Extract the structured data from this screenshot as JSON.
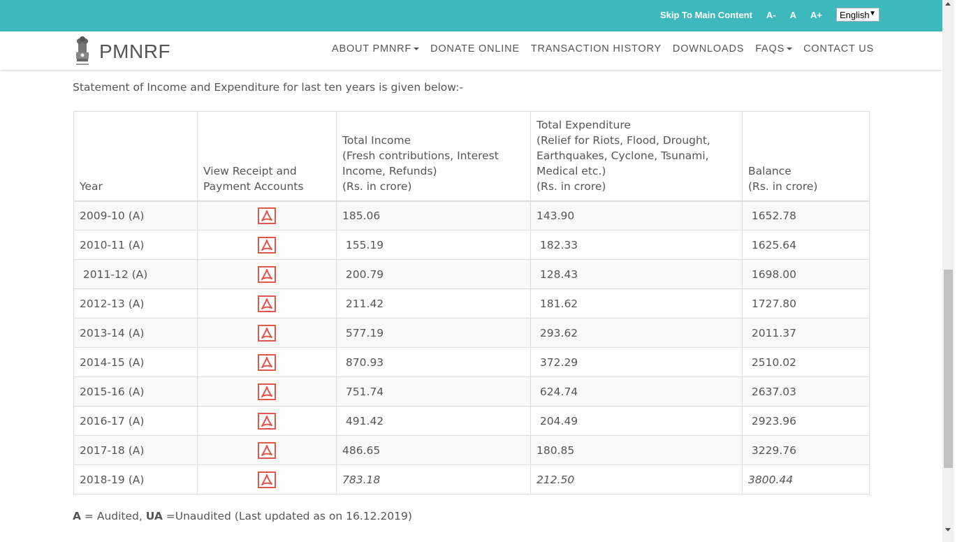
{
  "topbar": {
    "skip_link": "Skip To Main Content",
    "font_decrease": "A-",
    "font_normal": "A",
    "font_increase": "A+",
    "language": "English"
  },
  "nav": {
    "brand": "PMNRF",
    "items": [
      {
        "label": "ABOUT PMNRF",
        "dropdown": true
      },
      {
        "label": "DONATE ONLINE",
        "dropdown": false
      },
      {
        "label": "TRANSACTION HISTORY",
        "dropdown": false
      },
      {
        "label": "DOWNLOADS",
        "dropdown": false
      },
      {
        "label": "FAQS",
        "dropdown": true
      },
      {
        "label": "CONTACT US",
        "dropdown": false
      }
    ]
  },
  "intro": "Statement of Income and Expenditure for last ten years is given below:-",
  "table": {
    "headers": [
      [
        "Year"
      ],
      [
        "View Receipt and",
        "Payment Accounts"
      ],
      [
        "Total Income",
        "(Fresh contributions, Interest",
        "Income, Refunds)",
        "(Rs. in crore)"
      ],
      [
        "Total Expenditure",
        "(Relief for Riots, Flood, Drought,",
        "Earthquakes, Cyclone, Tsunami,",
        "Medical etc.)",
        "(Rs. in crore)"
      ],
      [
        "Balance",
        "(Rs. in crore)"
      ]
    ],
    "rows": [
      {
        "year": "2009-10 (A)",
        "income": "185.06",
        "expenditure": "143.90",
        "balance": " 1652.78",
        "italic": false
      },
      {
        "year": "2010-11 (A)",
        "income": " 155.19",
        "expenditure": " 182.33",
        "balance": " 1625.64",
        "italic": false
      },
      {
        "year": " 2011-12 (A)",
        "income": " 200.79",
        "expenditure": " 128.43",
        "balance": " 1698.00",
        "italic": false
      },
      {
        "year": "2012-13 (A)",
        "income": " 211.42",
        "expenditure": " 181.62",
        "balance": " 1727.80",
        "italic": false
      },
      {
        "year": "2013-14 (A)",
        "income": " 577.19",
        "expenditure": " 293.62",
        "balance": " 2011.37",
        "italic": false
      },
      {
        "year": "2014-15 (A)",
        "income": " 870.93",
        "expenditure": " 372.29",
        "balance": " 2510.02",
        "italic": false
      },
      {
        "year": "2015-16 (A)",
        "income": " 751.74",
        "expenditure": " 624.74",
        "balance": " 2637.03",
        "italic": false
      },
      {
        "year": "2016-17 (A)",
        "income": " 491.42",
        "expenditure": " 204.49",
        "balance": " 2923.96",
        "italic": false
      },
      {
        "year": "2017-18 (A)",
        "income": "486.65",
        "expenditure": "180.85",
        "balance": " 3229.76",
        "italic": false
      },
      {
        "year": "2018-19 (A)",
        "income": "783.18",
        "expenditure": "212.50",
        "balance": "3800.44",
        "italic": true
      }
    ]
  },
  "footnote": {
    "a_label": "A",
    "a_text": " = Audited, ",
    "ua_label": "UA",
    "ua_text": " =Unaudited (Last updated as on  16.12.2019)"
  },
  "colors": {
    "topbar": "#3db9be",
    "pdf_icon": "#e2574c"
  }
}
